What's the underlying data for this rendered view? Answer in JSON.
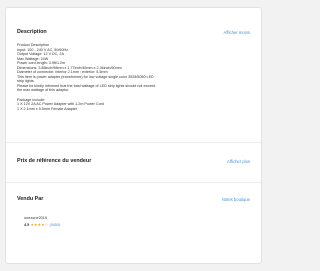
{
  "description": {
    "title": "Description",
    "toggle_label": "Afficher moins",
    "lines": [
      "Product Description",
      "Input: 100 - 240 V AC, 50/60Hz",
      "Output Voltage: 12 V DC, 2A",
      "Max Wattage: 24W",
      "Power cord length: 3.9ft/1.2m",
      "Dimensions: 3.86inch/98mm x 1.77inch/45mm x 2.36inch/60mm",
      "Diameter of connector: interior 2.1mm ; exterior: 5.5mm",
      "This item is power adapter (transformer) for low voltage single color 3528/5050 LED",
      "strip lights.",
      "Please be kindly informed that the total wattage of LED strip lights should not exceed",
      "the max wattage of this adaptor."
    ],
    "package_lines": [
      "Package include:",
      "1 X 12V 2A AC Power Adapter with 1.2m Power Cord",
      "1 X 2.1mm x 5.5mm Female Adapter"
    ]
  },
  "reference_price": {
    "title": "Prix de référence du vendeur",
    "link_label": "Afficher plus"
  },
  "seller": {
    "title": "Vendu Par",
    "link_label": "Notes boutique",
    "name": "onezone2019",
    "rating": "4.5",
    "stars": "★★★★☆",
    "review_count": "(5455)"
  },
  "colors": {
    "accent": "#4a90d9",
    "star": "#f5a623"
  }
}
